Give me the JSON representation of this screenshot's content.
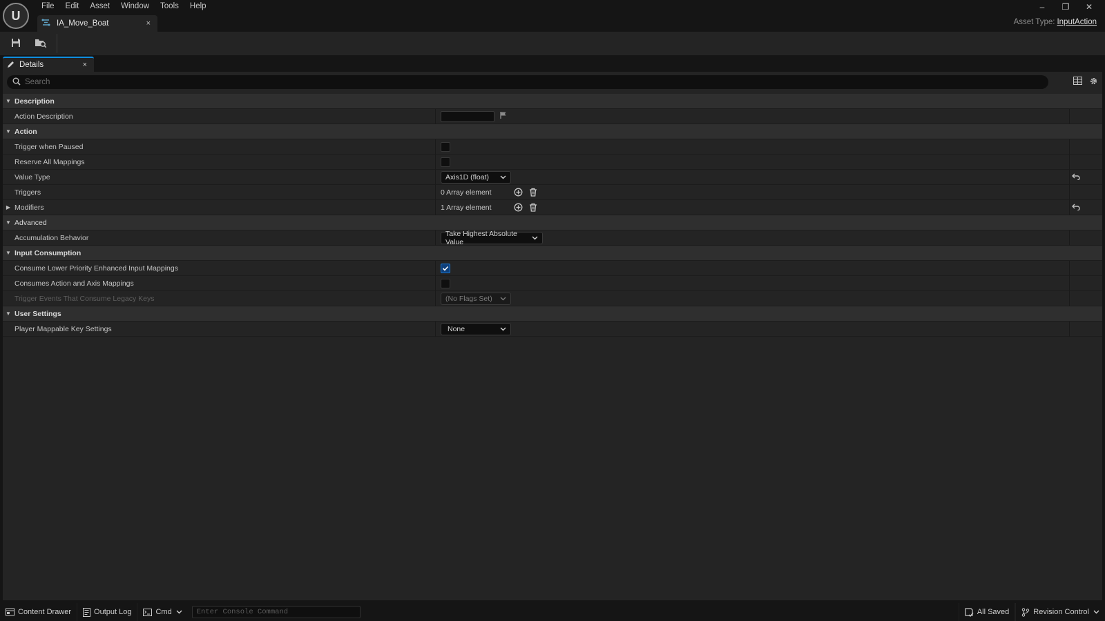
{
  "app": {
    "logo_text": "U",
    "menu": [
      "File",
      "Edit",
      "Asset",
      "Window",
      "Tools",
      "Help"
    ],
    "window_controls": {
      "minimize": "–",
      "restore": "❐",
      "close": "✕"
    },
    "tab": {
      "label": "IA_Move_Boat",
      "close": "×"
    },
    "asset_type_label": "Asset Type:",
    "asset_type_value": "InputAction"
  },
  "toolbar": {
    "buttons": [
      {
        "icon": "save-icon"
      },
      {
        "icon": "browse-to-asset-icon"
      }
    ]
  },
  "panel": {
    "tab_label": "Details",
    "tab_close": "×",
    "search_placeholder": "Search"
  },
  "rows": {
    "description": {
      "label": "Description"
    },
    "action_description": {
      "label": "Action Description",
      "value": ""
    },
    "action": {
      "label": "Action"
    },
    "trigger_when_paused": {
      "label": "Trigger when Paused",
      "checked": false
    },
    "reserve_all_mappings": {
      "label": "Reserve All Mappings",
      "checked": false
    },
    "value_type": {
      "label": "Value Type",
      "value": "Axis1D (float)"
    },
    "triggers": {
      "label": "Triggers",
      "value": "0 Array element"
    },
    "modifiers": {
      "label": "Modifiers",
      "value": "1 Array element"
    },
    "advanced": {
      "label": "Advanced"
    },
    "accumulation_behavior": {
      "label": "Accumulation Behavior",
      "value": "Take Highest Absolute Value"
    },
    "input_consumption": {
      "label": "Input Consumption"
    },
    "consume_lower_priority": {
      "label": "Consume Lower Priority Enhanced Input Mappings",
      "checked": true
    },
    "consumes_action_axis": {
      "label": "Consumes Action and Axis Mappings",
      "checked": false
    },
    "trigger_events_legacy": {
      "label": "Trigger Events That Consume Legacy Keys",
      "value": "(No Flags Set)"
    },
    "user_settings": {
      "label": "User Settings"
    },
    "player_mappable_key_settings": {
      "label": "Player Mappable Key Settings",
      "value": "None"
    }
  },
  "statusbar": {
    "content_drawer": "Content Drawer",
    "output_log": "Output Log",
    "cmd": "Cmd",
    "console_placeholder": "Enter Console Command",
    "all_saved": "All Saved",
    "revision_control": "Revision Control"
  },
  "colors": {
    "accent": "#0e8ee0",
    "panel_bg": "#242424",
    "category_bg": "#2f2f2f",
    "window_bg": "#151515"
  }
}
